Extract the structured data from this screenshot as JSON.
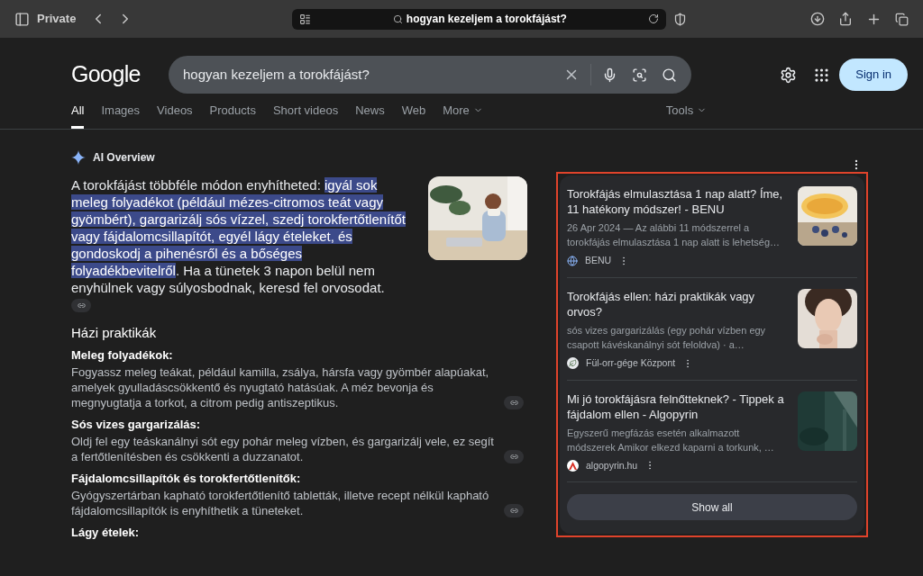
{
  "browser": {
    "private_label": "Private",
    "address": "hogyan kezeljem a torokfájást?"
  },
  "header": {
    "logo": "Google",
    "query": "hogyan kezeljem a torokfájást?",
    "sign_in": "Sign in"
  },
  "tabs": [
    {
      "label": "All",
      "selected": true,
      "dropdown": false
    },
    {
      "label": "Images",
      "selected": false,
      "dropdown": false
    },
    {
      "label": "Videos",
      "selected": false,
      "dropdown": false
    },
    {
      "label": "Products",
      "selected": false,
      "dropdown": false
    },
    {
      "label": "Short videos",
      "selected": false,
      "dropdown": false
    },
    {
      "label": "News",
      "selected": false,
      "dropdown": false
    },
    {
      "label": "Web",
      "selected": false,
      "dropdown": false
    },
    {
      "label": "More",
      "selected": false,
      "dropdown": true
    }
  ],
  "tools": "Tools",
  "ai_overview": {
    "title": "AI Overview",
    "paragraph": [
      {
        "text": "A torokfájást többféle módon enyhítheted: ",
        "highlighted": false
      },
      {
        "text": "igyál sok meleg folyadékot (például mézes-citromos teát vagy gyömbért), gargarizálj sós vízzel, szedj torokfertőtlenítőt vagy fájdalomcsillapítót, egyél lágy ételeket, és gondoskodj a pihenésről és a bőséges folyadékbevitelről",
        "highlighted": true
      },
      {
        "text": ". Ha a tünetek 3 napon belül nem enyhülnek vagy súlyosbodnak, keresd fel orvosodat.",
        "highlighted": false
      }
    ],
    "section_title": "Házi praktikák",
    "items": [
      {
        "heading": "Meleg folyadékok:",
        "text": "Fogyassz meleg teákat, például kamilla, zsálya, hársfa vagy gyömbér alapúakat, amelyek gyulladáscsökkentő és nyugtató hatásúak. A méz bevonja és megnyugtatja a torkot, a citrom pedig antiszeptikus."
      },
      {
        "heading": "Sós vizes gargarizálás:",
        "text": "Oldj fel egy teáskanálnyi sót egy pohár meleg vízben, és gargarizálj vele, ez segít a fertőtlenítésben és csökkenti a duzzanatot."
      },
      {
        "heading": "Fájdalomcsillapítók és torokfertőtlenítők:",
        "text": "Gyógyszertárban kapható torokfertőtlenítő tabletták, illetve recept nélkül kapható fájdalomcsillapítók is enyhíthetik a tüneteket."
      },
      {
        "heading": "Lágy ételek:"
      }
    ]
  },
  "sources": {
    "items": [
      {
        "title": "Torokfájás elmulasztása 1 nap alatt? Íme, 11 hatékony módszer! - BENU",
        "snippet": "26 Apr 2024 — Az alábbi 11 módszerrel a torokfájás elmulasztása 1 nap alatt is lehetség…",
        "site": "BENU",
        "kind": "globe"
      },
      {
        "title": "Torokfájás ellen: házi praktikák vagy orvos?",
        "snippet": "sós vizes gargarizálás (egy pohár vízben egy csapott kávéskanálnyi sót feloldva) · a…",
        "site": "Fül-orr-gége Központ",
        "kind": "leaf"
      },
      {
        "title": "Mi jó torokfájásra felnőtteknek? - Tippek a fájdalom ellen - Algopyrin",
        "snippet": "Egyszerű megfázás esetén alkalmazott módszerek Amikor elkezd kaparni a torkunk, …",
        "site": "algopyrin.hu",
        "kind": "letter-a"
      }
    ],
    "show_all": "Show all"
  }
}
